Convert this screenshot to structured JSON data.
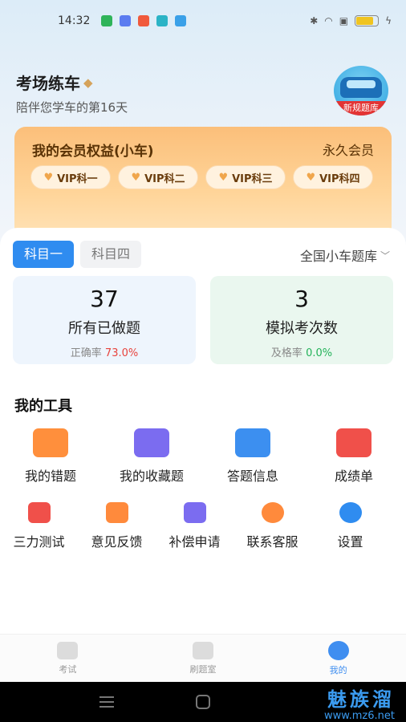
{
  "status_bar": {
    "time": "14:32",
    "app_icon_colors": [
      "#2fb45a",
      "#5b7cf0",
      "#f05a3c",
      "#2bb3c6",
      "#3aa0e8"
    ]
  },
  "header": {
    "title": "考场练车",
    "subtitle": "陪伴您学车的第16天",
    "badge_label": "新规题库"
  },
  "vip": {
    "title": "我的会员权益(小车)",
    "permanent": "永久会员",
    "pills": [
      "VIP科一",
      "VIP科二",
      "VIP科三",
      "VIP科四"
    ]
  },
  "subject_tabs": [
    "科目一",
    "科目四"
  ],
  "active_tab": "科目一",
  "question_bank": "全国小车题库",
  "stats": {
    "done": {
      "value": "37",
      "label": "所有已做题",
      "rate_label": "正确率",
      "rate_value": "73.0%"
    },
    "exam": {
      "value": "3",
      "label": "模拟考次数",
      "rate_label": "及格率",
      "rate_value": "0.0%"
    }
  },
  "tools": {
    "title": "我的工具",
    "row1": [
      {
        "label": "我的错题",
        "icon": "wrong-questions-icon",
        "color": "#ff8f3c"
      },
      {
        "label": "我的收藏题",
        "icon": "favorites-icon",
        "color": "#7b6cf0"
      },
      {
        "label": "答题信息",
        "icon": "answer-info-icon",
        "color": "#3c8ff0"
      },
      {
        "label": "成绩单",
        "icon": "report-card-icon",
        "color": "#f0504a"
      }
    ],
    "row2": [
      {
        "label": "三力测试",
        "icon": "edit-test-icon",
        "color": "#f0504a"
      },
      {
        "label": "意见反馈",
        "icon": "feedback-icon",
        "color": "#ff8a3c"
      },
      {
        "label": "补偿申请",
        "icon": "compensation-icon",
        "color": "#7b6cf0"
      },
      {
        "label": "联系客服",
        "icon": "customer-service-icon",
        "color": "#ff8a3c"
      },
      {
        "label": "设置",
        "icon": "settings-gear-icon",
        "color": "#2f8cf0"
      }
    ]
  },
  "bottom_nav": [
    {
      "label": "考试",
      "active": false
    },
    {
      "label": "刷题室",
      "active": false
    },
    {
      "label": "我的",
      "active": true
    }
  ],
  "watermark": {
    "name": "魅族溜",
    "url": "www.mz6.net"
  }
}
